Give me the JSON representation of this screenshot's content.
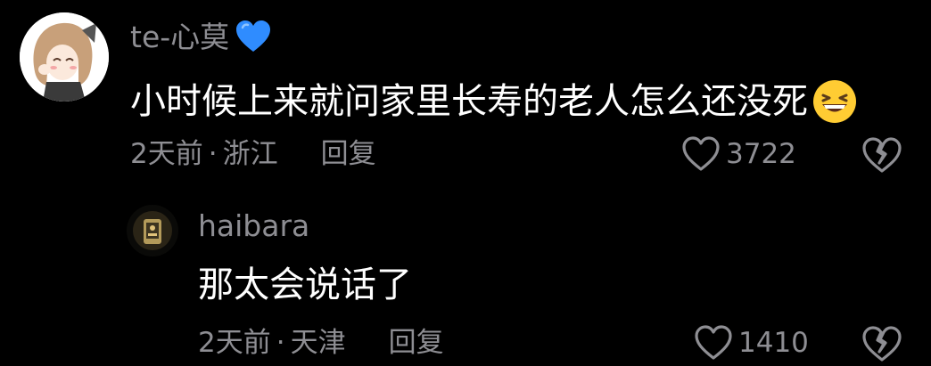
{
  "comments": [
    {
      "username": "te-心莫",
      "badge_icon": "blue-heart-icon",
      "text": "小时候上来就问家里长寿的老人怎么还没死",
      "emoji": "grinning-squinting-face-emoji",
      "time": "2天前",
      "separator": "·",
      "location": "浙江",
      "reply_label": "回复",
      "likes": "3722"
    },
    {
      "username": "haibara",
      "text": "那太会说话了",
      "time": "2天前",
      "separator": "·",
      "location": "天津",
      "reply_label": "回复",
      "likes": "1410"
    }
  ],
  "colors": {
    "background": "#000000",
    "primary_text": "#ffffff",
    "secondary_text": "#8e8e93",
    "badge": "#2f8cff"
  }
}
